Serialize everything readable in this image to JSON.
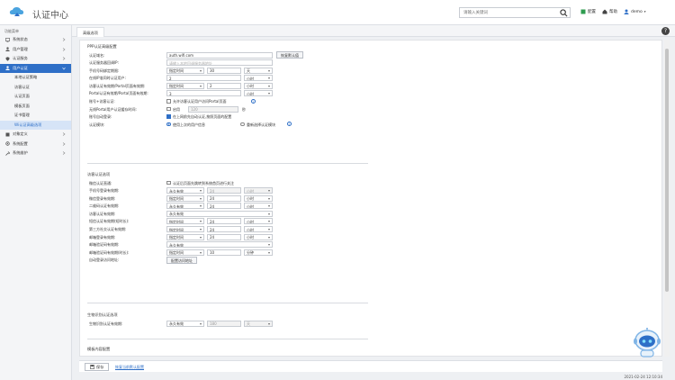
{
  "app": {
    "title": "认证中心"
  },
  "search": {
    "placeholder": "请输入关键词",
    "value": ""
  },
  "top_actions": [
    {
      "label": "配置",
      "icon": "config-icon"
    },
    {
      "label": "帮助",
      "icon": "home-icon"
    },
    {
      "label": "demo",
      "icon": "user-icon"
    }
  ],
  "sidebar": {
    "header": "功能菜单",
    "items": [
      {
        "label": "系统状态",
        "icon": "monitor-icon"
      },
      {
        "label": "用户管理",
        "icon": "users-icon"
      },
      {
        "label": "认证服务",
        "icon": "shield-icon"
      },
      {
        "label": "用户认证",
        "icon": "user-check-icon",
        "active": true
      }
    ],
    "sub_items": [
      {
        "label": "本地认证策略"
      },
      {
        "label": "访客认证"
      },
      {
        "label": "认证页面"
      },
      {
        "label": "模板页面"
      },
      {
        "label": "证书管理"
      },
      {
        "label": "Wi认证高级选项",
        "active": true
      }
    ],
    "items2": [
      {
        "label": "对象定义",
        "icon": "object-icon"
      },
      {
        "label": "系统配置",
        "icon": "settings-icon"
      },
      {
        "label": "系统维护",
        "icon": "tools-icon"
      }
    ]
  },
  "tab": {
    "label": "高级选项"
  },
  "section1": {
    "title": "PPP认证高级配置",
    "domain_label": "认证域名:",
    "domain_value": "auth.wifi.com",
    "domain_button": "恢复默认值",
    "ip_label": "认证服务器回调IP:",
    "ip_placeholder": "请输入本地回调服务器地址",
    "phone_label": "手机号码绑定期限:",
    "phone_sel": "指定时间",
    "phone_num": "30",
    "phone_unit": "天",
    "dup_label": "在线IP准同时认证用户:",
    "dup_value": "2",
    "dup_unit": "小时",
    "ref_label": "访客认证有效期/Portal页面有效期:",
    "ref_sel": "指定时间",
    "ref_num": "2",
    "ref_unit": "小时",
    "cache_label": "Portal认证有效期/Portal页面有效期:",
    "cache_value": "3",
    "cache_unit": "小时",
    "acct_label": "账号+访客认证:",
    "acct_text": "允许访客认证用户访问Portal页面",
    "pwd_label": "无线Portal用户认证缓存时间:",
    "pwd_check": "启用",
    "pwd_value": "120",
    "pwd_unit": "秒",
    "auto_label": "账号自动登录:",
    "auto_text": "在上网前先自动认证,按照页面的配置",
    "mode_label": "认证模块:",
    "mode_opt1": "使用上次的用户信息",
    "mode_opt2": "重新选择认证模块"
  },
  "section2": {
    "title": "访客认证选项",
    "r1_label": "微信认证直通:",
    "r1_text": "认证后页面先跳转到系统首页进行关注",
    "rows": [
      {
        "label": "手机号登录有效期:",
        "sel": "永久有效",
        "num": "24",
        "unit": "小时",
        "dis": true
      },
      {
        "label": "微信登录有效期:",
        "sel": "指定时间",
        "num": "24",
        "unit": "小时"
      },
      {
        "label": "二维码认证有效期:",
        "sel": "永久有效",
        "num": "24",
        "unit": "小时"
      },
      {
        "label": "访客认证有效期:",
        "sel": "永久有效",
        "num": "",
        "unit": ""
      },
      {
        "label": "短信认证有效期(短时长):",
        "sel": "指定时间",
        "num": "24",
        "unit": "小时"
      },
      {
        "label": "第三方社交认证有效期:",
        "sel": "指定时间",
        "num": "24",
        "unit": "小时"
      },
      {
        "label": "邮箱登录有效期:",
        "sel": "指定时间",
        "num": "24",
        "unit": "小时"
      },
      {
        "label": "邮箱验证码有效期:",
        "sel": "永久有效",
        "num": "",
        "unit": ""
      },
      {
        "label": "邮箱验证码有效期(时长):",
        "sel": "指定时间",
        "num": "10",
        "unit": "分钟"
      }
    ],
    "last_label": "自动登录访问地址:",
    "last_button": "配置访问地址"
  },
  "section3": {
    "title": "生物识别认证选项",
    "row_label": "生物识别认证有效期:",
    "row_sel": "永久有效",
    "row_num": "180",
    "row_unit": "天"
  },
  "section4": {
    "title": "模板内容配置"
  },
  "bottom": {
    "save": "保存",
    "link": "恢复当前默认配置"
  },
  "status": {
    "datetime": "2021-02-24 12:10:34"
  },
  "colors": {
    "accent": "#2e6fc7",
    "logo": "#4aa3df"
  }
}
